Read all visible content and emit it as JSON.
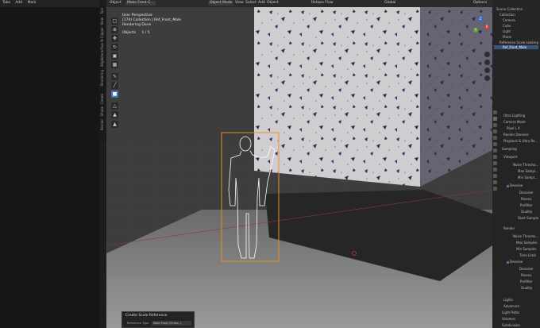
{
  "left_header": {
    "items": [
      "Take",
      "Add",
      "Mark"
    ]
  },
  "side_tabs": [
    "Tool",
    "View",
    "N-Clipper",
    "Interactive",
    "Align",
    "Blender",
    "Rendering",
    "Create",
    "Shade",
    "Item",
    "Rigify",
    "Render"
  ],
  "viewport_header": {
    "editor_label": "Object",
    "object_selector": "Make Front C...",
    "mode": "Object Mode",
    "menus": [
      "View",
      "Select",
      "Add",
      "Object"
    ],
    "transform_label": "Global",
    "pivot_label": "Retopo Flow",
    "options_label": "Options"
  },
  "overlay_info": {
    "line1": "User Perspective",
    "line2": "(174) Collection | Ref_Front_Male",
    "line3": "Rendering Done",
    "objects_label": "Objects",
    "objects_value": "1 / 5"
  },
  "gizmo": {
    "x": "X",
    "y": "Y",
    "z": "Z"
  },
  "outliner": {
    "title": "Scene Collection",
    "items": [
      "Collection",
      "Camera",
      "Cube",
      "Light",
      "Plane",
      "Reference Scale Looking",
      "Ref_Front_Male"
    ]
  },
  "properties": {
    "rows": [
      "Ultra Lighting",
      "Camera Mode",
      "Pixel L X",
      "Render Denoise",
      "Playback & Ultra Re...",
      "Sampling",
      "Viewport",
      "Noise Thresho...",
      "Max Sampl...",
      "Min Sampl...",
      "Denoise",
      "Denoiser",
      "Passes",
      "Prefilter",
      "Quality",
      "Start Sample",
      "Render",
      "Noise Thresho...",
      "Max Samples",
      "Min Samples",
      "Time Limit",
      "Denoise",
      "Denoiser",
      "Passes",
      "Prefilter",
      "Quality",
      "Lights",
      "Advanced",
      "Light Paths",
      "Volumes",
      "Subdivision"
    ]
  },
  "redo_panel": {
    "title": "Create Scale Reference",
    "field_label": "Reference Type",
    "field_value": "Male Front (Ortho..)"
  },
  "colors": {
    "accent": "#4772b3",
    "selection": "#e8902c",
    "light_outline": "#ffffff"
  }
}
